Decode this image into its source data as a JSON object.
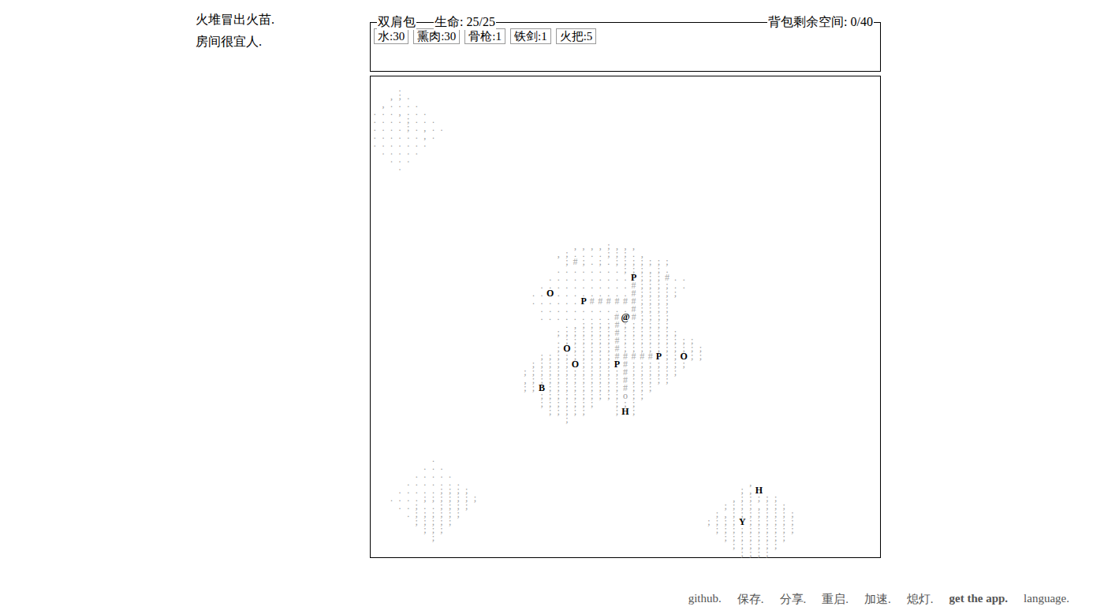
{
  "notifications": [
    "火堆冒出火苗.",
    "房间很宜人."
  ],
  "backpack": {
    "title": "双肩包",
    "health": "生命: 25/25",
    "free_space": "背包剩余空间: 0/40",
    "items": [
      {
        "label": "水:30"
      },
      {
        "label": "熏肉:30"
      },
      {
        "label": "骨枪:1"
      },
      {
        "label": "铁剑:1"
      },
      {
        "label": "火把:5"
      }
    ]
  },
  "map": {
    "rows": [
      "",
      "   .",
      "  ,;.",
      " ,....",
      "...,...",
      "....;...",
      "....;.,..",
      "......,.",
      ".......",
      " .....",
      "  ...",
      "   .",
      "",
      "",
      "",
      "",
      "",
      "",
      "",
      "",
      "",
      "                        ,,,,;,,,",
      "                      ,;....;;;.,",
      "                       ;#;.;.;;;;;;;",
      "                      ........;;;,;.",
      "                     ..........P;;;#..",
      "                    ...........#;;;;..",
      "                   ..O.........#;;;;;",
      "                   ......P######;;;;",
      "                    ...........#;;;;",
      "                    .........#@#;;;;",
      "                       .,;;;;#;;;;;;",
      "                      ;;;;;;;#;;;;;;;",
      "                      .;;;;;;#;;;;;;;;;",
      "                      ;O;;;;;#;;;;;;;;;;",
      "                    ;;;;;;;;;#####P;;O;;",
      "                   ;;;;;O;;;;P#;;;;;;;",
      "                  ;;;;;;;;;;;;#;;;;;;",
      "                  ,;;;;;;;;;;;#;;;;;",
      "                  ;;B;;;;;;;;;#;;;",
      "                    ;;;;;;;;;;o;;",
      "                    ;;;;;;;  ;;;",
      "                     ;;;;;   ;H;",
      "                       ;",
      "",
      "",
      "",
      "",
      "       .",
      "      ...",
      "     .....",
      "    .......                                  ,",
      "   .....;;;;                                ;,H",
      "  ....;;;;;;;                              ,;;;;;",
      "   ..;..;;;;                              ;;;;,;;;",
      "    .;;;;;;                              ;,;;;;;;;;",
      "     ;;;;;                              ;;;;Y;;;;;;",
      "      ;;;                                ;;;;;;;;;;",
      "       ;                                  ;;;;;;;;",
      "                                           ;;;;;;",
      "                                            ;;;;"
    ]
  },
  "menu": [
    {
      "label": "github.",
      "bold": false
    },
    {
      "label": "保存.",
      "bold": false
    },
    {
      "label": "分享.",
      "bold": false
    },
    {
      "label": "重启.",
      "bold": false
    },
    {
      "label": "加速.",
      "bold": false
    },
    {
      "label": "熄灯.",
      "bold": false
    },
    {
      "label": "get the app.",
      "bold": true
    },
    {
      "label": "language.",
      "bold": false
    }
  ]
}
